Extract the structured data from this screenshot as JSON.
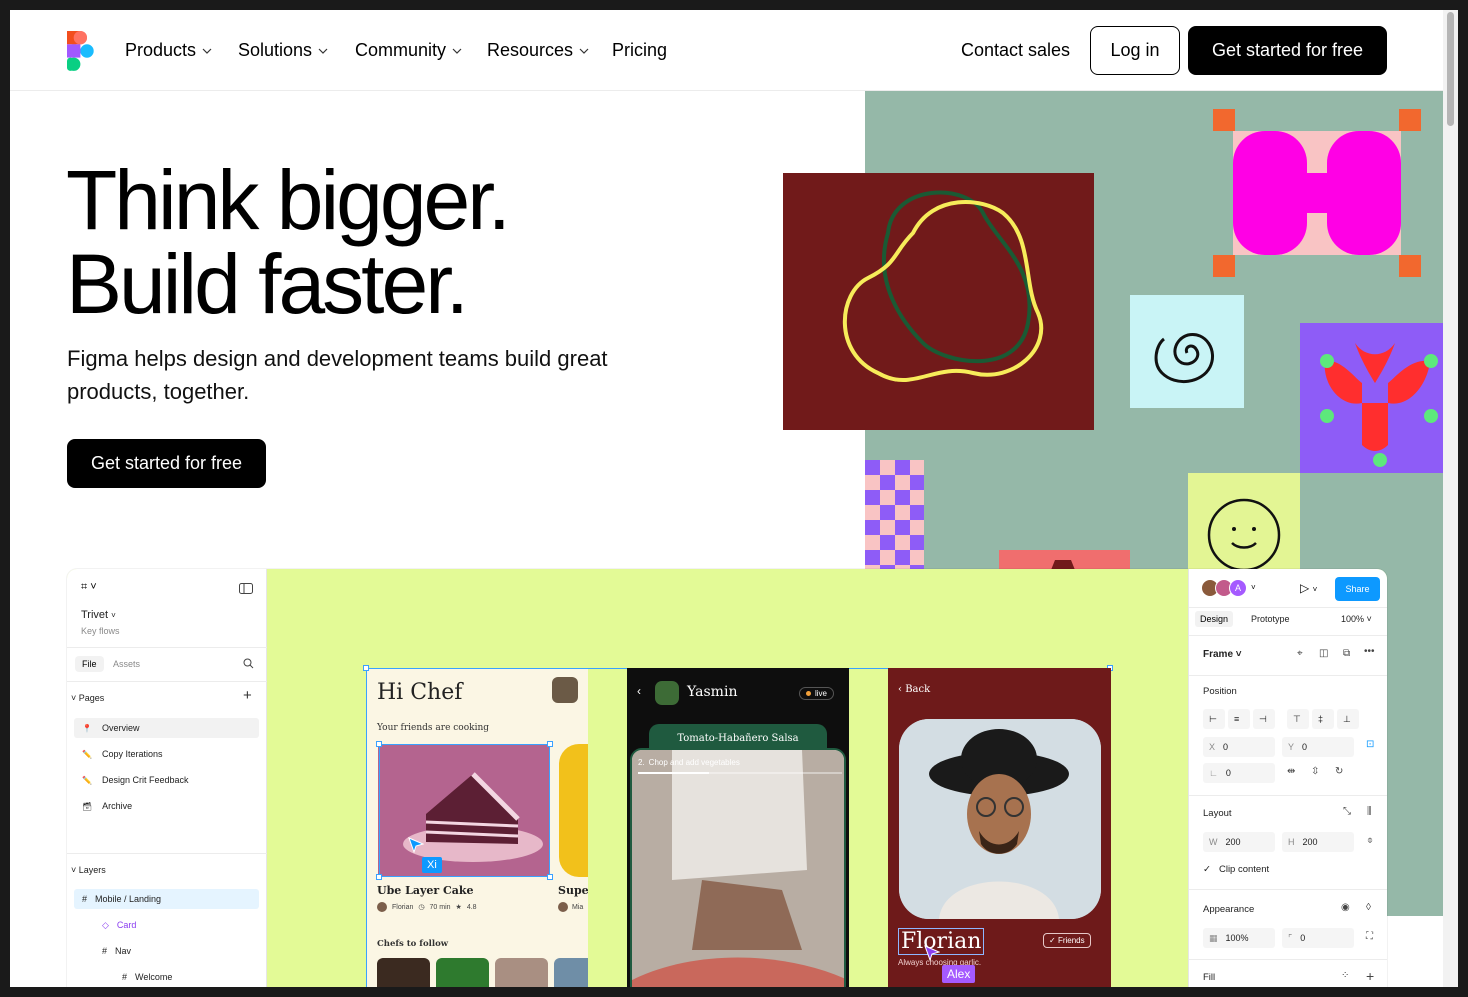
{
  "nav": {
    "items": [
      {
        "label": "Products",
        "dropdown": true
      },
      {
        "label": "Solutions",
        "dropdown": true
      },
      {
        "label": "Community",
        "dropdown": true
      },
      {
        "label": "Resources",
        "dropdown": true
      },
      {
        "label": "Pricing",
        "dropdown": false
      }
    ],
    "contact": "Contact sales",
    "login": "Log in",
    "cta": "Get started for free"
  },
  "hero": {
    "title_line1": "Think bigger.",
    "title_line2": "Build faster.",
    "subtitle": "Figma helps design and development teams build great products, together.",
    "cta": "Get started for free"
  },
  "editor": {
    "file_name": "Trivet",
    "file_sub": "Key flows",
    "tabs": [
      "File",
      "Assets"
    ],
    "pages_label": "Pages",
    "pages": [
      {
        "icon": "pin-icon",
        "label": "Overview",
        "selected": true
      },
      {
        "icon": "pencil-icon",
        "label": "Copy Iterations",
        "selected": false
      },
      {
        "icon": "pencil-icon",
        "label": "Design Crit Feedback",
        "selected": false
      },
      {
        "icon": "archive-icon",
        "label": "Archive",
        "selected": false
      }
    ],
    "layers_label": "Layers",
    "layers": [
      {
        "label": "Mobile / Landing",
        "type": "frame"
      },
      {
        "label": "Card",
        "type": "component"
      },
      {
        "label": "Nav",
        "type": "frame"
      },
      {
        "label": "Welcome",
        "type": "frame"
      }
    ],
    "right": {
      "avatar_letter": "A",
      "share": "Share",
      "tab_design": "Design",
      "tab_prototype": "Prototype",
      "zoom": "100%",
      "frame_label": "Frame",
      "position_label": "Position",
      "x_label": "X",
      "x_value": "0",
      "y_label": "Y",
      "y_value": "0",
      "rotation_value": "0",
      "layout_label": "Layout",
      "w_label": "W",
      "w_value": "200",
      "h_label": "H",
      "h_value": "200",
      "clip_content": "Clip content",
      "appearance_label": "Appearance",
      "opacity_value": "100%",
      "radius_value": "0",
      "fill_label": "Fill"
    },
    "screens": {
      "chef": {
        "greeting": "Hi Chef",
        "friends_cooking": "Your friends are cooking",
        "card1_title": "Ube Layer Cake",
        "card1_author": "Florian",
        "card1_time": "70 min",
        "card1_rating": "4.8",
        "card2_title": "Super",
        "card2_author": "Mia",
        "chefs_to_follow": "Chefs to follow",
        "cursor_name": "Xi"
      },
      "yasmin": {
        "name": "Yasmin",
        "live": "live",
        "recipe": "Tomato-Habañero Salsa",
        "step_num": "2.",
        "step": "Chop and add vegetables"
      },
      "florian": {
        "back": "Back",
        "name": "Florian",
        "friends": "Friends",
        "caption": "Always choosing garlic.",
        "cursor_name": "Alex"
      }
    }
  },
  "colors": {
    "black": "#000000",
    "art_green": "#95b8a8",
    "maroon": "#711a1a",
    "magenta": "#ff00e5",
    "purple": "#8e5cf7",
    "lime": "#e3fa96",
    "blue": "#0d99ff"
  }
}
